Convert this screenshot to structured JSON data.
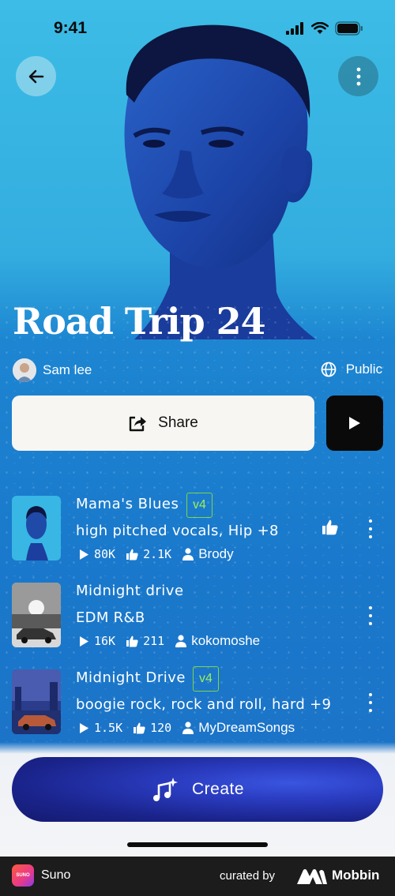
{
  "status_bar": {
    "time": "9:41"
  },
  "playlist": {
    "title": "Road Trip 24",
    "owner": "Sam lee",
    "visibility": "Public"
  },
  "actions": {
    "share_label": "Share"
  },
  "songs": [
    {
      "title": "Mama's Blues",
      "badge": "v4",
      "tags": "high pitched vocals, Hip +8",
      "plays": "80K",
      "likes": "2.1K",
      "user": "Brody",
      "liked": true
    },
    {
      "title": "Midnight drive",
      "badge": "",
      "tags": "EDM R&B",
      "plays": "16K",
      "likes": "211",
      "user": "kokomoshe",
      "liked": false
    },
    {
      "title": "Midnight Drive",
      "badge": "v4",
      "tags": "boogie rock, rock and roll, hard +9",
      "plays": "1.5K",
      "likes": "120",
      "user": "MyDreamSongs",
      "liked": false
    }
  ],
  "bottom": {
    "create_label": "Create"
  },
  "footer": {
    "app_name": "Suno",
    "curated_by": "curated by",
    "brand": "Mobbin",
    "app_icon_text": "SUNO"
  },
  "colors": {
    "badge_green": "#7cd648",
    "accent_blue": "#1a79cc",
    "create_gradient": "#1a238a"
  },
  "icons": [
    "back-arrow-icon",
    "more-vertical-icon",
    "globe-icon",
    "share-icon",
    "play-icon",
    "thumbs-up-icon",
    "user-icon",
    "music-sparkle-icon"
  ]
}
